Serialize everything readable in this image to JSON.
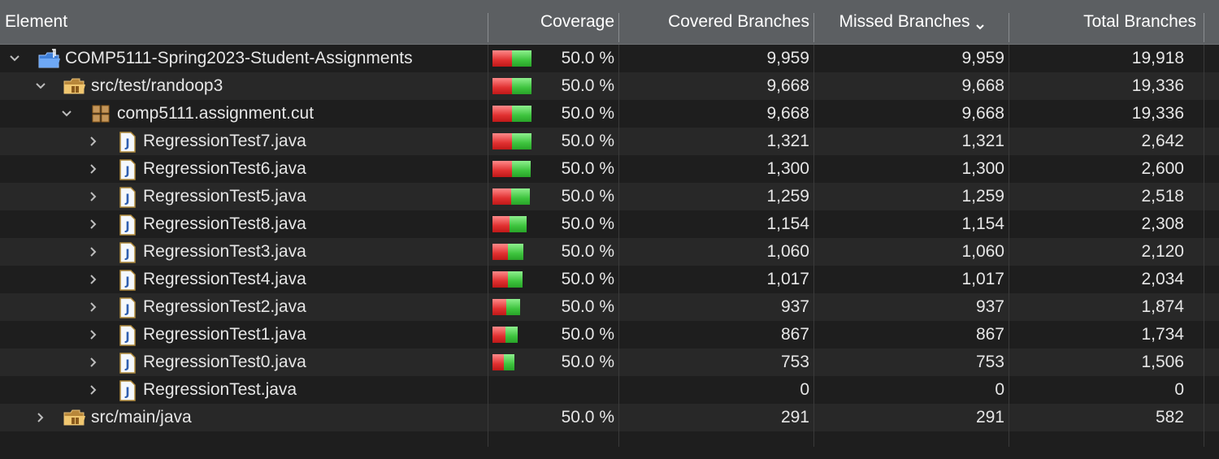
{
  "columns": {
    "element": "Element",
    "coverage": "Coverage",
    "covered": "Covered Branches",
    "missed": "Missed Branches",
    "total": "Total Branches"
  },
  "rows": [
    {
      "name": "COMP5111-Spring2023-Student-Assignments",
      "icon": "project-folder-icon",
      "level": 0,
      "expanded": true,
      "coverage": "50.0 %",
      "covered": "9,959",
      "missed": "9,959",
      "total": "19,918",
      "bar": 1
    },
    {
      "name": "src/test/randoop3",
      "icon": "package-folder-icon",
      "level": 1,
      "expanded": true,
      "coverage": "50.0 %",
      "covered": "9,668",
      "missed": "9,668",
      "total": "19,336",
      "bar": 1
    },
    {
      "name": "comp5111.assignment.cut",
      "icon": "package-icon",
      "level": 2,
      "expanded": true,
      "coverage": "50.0 %",
      "covered": "9,668",
      "missed": "9,668",
      "total": "19,336",
      "bar": 1
    },
    {
      "name": "RegressionTest7.java",
      "icon": "java-file-icon",
      "level": 3,
      "expanded": false,
      "coverage": "50.0 %",
      "covered": "1,321",
      "missed": "1,321",
      "total": "2,642",
      "bar": 1
    },
    {
      "name": "RegressionTest6.java",
      "icon": "java-file-icon",
      "level": 3,
      "expanded": false,
      "coverage": "50.0 %",
      "covered": "1,300",
      "missed": "1,300",
      "total": "2,600",
      "bar": 0.984
    },
    {
      "name": "RegressionTest5.java",
      "icon": "java-file-icon",
      "level": 3,
      "expanded": false,
      "coverage": "50.0 %",
      "covered": "1,259",
      "missed": "1,259",
      "total": "2,518",
      "bar": 0.953
    },
    {
      "name": "RegressionTest8.java",
      "icon": "java-file-icon",
      "level": 3,
      "expanded": false,
      "coverage": "50.0 %",
      "covered": "1,154",
      "missed": "1,154",
      "total": "2,308",
      "bar": 0.874
    },
    {
      "name": "RegressionTest3.java",
      "icon": "java-file-icon",
      "level": 3,
      "expanded": false,
      "coverage": "50.0 %",
      "covered": "1,060",
      "missed": "1,060",
      "total": "2,120",
      "bar": 0.802
    },
    {
      "name": "RegressionTest4.java",
      "icon": "java-file-icon",
      "level": 3,
      "expanded": false,
      "coverage": "50.0 %",
      "covered": "1,017",
      "missed": "1,017",
      "total": "2,034",
      "bar": 0.77
    },
    {
      "name": "RegressionTest2.java",
      "icon": "java-file-icon",
      "level": 3,
      "expanded": false,
      "coverage": "50.0 %",
      "covered": "937",
      "missed": "937",
      "total": "1,874",
      "bar": 0.709
    },
    {
      "name": "RegressionTest1.java",
      "icon": "java-file-icon",
      "level": 3,
      "expanded": false,
      "coverage": "50.0 %",
      "covered": "867",
      "missed": "867",
      "total": "1,734",
      "bar": 0.656
    },
    {
      "name": "RegressionTest0.java",
      "icon": "java-file-icon",
      "level": 3,
      "expanded": false,
      "coverage": "50.0 %",
      "covered": "753",
      "missed": "753",
      "total": "1,506",
      "bar": 0.57
    },
    {
      "name": "RegressionTest.java",
      "icon": "java-file-icon",
      "level": 3,
      "expanded": false,
      "coverage": "",
      "covered": "0",
      "missed": "0",
      "total": "0",
      "bar": 0
    },
    {
      "name": "src/main/java",
      "icon": "package-folder-icon",
      "level": 1,
      "expanded": false,
      "coverage": "50.0 %",
      "covered": "291",
      "missed": "291",
      "total": "582",
      "bar": 0
    }
  ]
}
